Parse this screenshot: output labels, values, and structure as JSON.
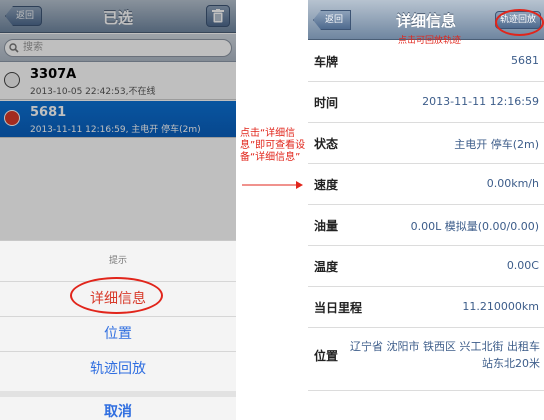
{
  "left_screen": {
    "nav": {
      "back_label": "返回",
      "title": "已选"
    },
    "search": {
      "placeholder": "搜索"
    },
    "vehicles": [
      {
        "plate": "3307A",
        "info": "2013-10-05 22:42:53,不在线"
      },
      {
        "plate": "5681",
        "info": "2013-11-11 12:16:59, 主电开 停车(2m)"
      }
    ],
    "action_sheet": {
      "title": "提示",
      "buttons": [
        "详细信息",
        "位置",
        "轨迹回放",
        "取消"
      ]
    }
  },
  "annotation": {
    "text": "点击“详细信息”即可查看设备“详细信息”",
    "hint": "点击可回放轨迹"
  },
  "right_screen": {
    "nav": {
      "back_label": "返回",
      "title": "详细信息",
      "playback_label": "轨迹回放"
    },
    "details": [
      {
        "label": "车牌",
        "value": "5681"
      },
      {
        "label": "时间",
        "value": "2013-11-11 12:16:59"
      },
      {
        "label": "状态",
        "value": "主电开  停车(2m)"
      },
      {
        "label": "速度",
        "value": "0.00km/h"
      },
      {
        "label": "油量",
        "value": "0.00L 模拟量(0.00/0.00)"
      },
      {
        "label": "温度",
        "value": "0.00C"
      },
      {
        "label": "当日里程",
        "value": "11.210000km"
      },
      {
        "label": "位置",
        "value": "辽宁省 沈阳市 铁西区 兴工北街 出租车站东北20米"
      }
    ]
  },
  "colors": {
    "accent_red": "#e1251b",
    "selection_blue": "#0b6cd0",
    "action_blue": "#2f6ee0",
    "nav_gradient_top": "#b7c3d0",
    "nav_gradient_bottom": "#6f86a0"
  },
  "icons": [
    "trash-icon",
    "search-icon",
    "vehicle-offline-icon",
    "vehicle-online-icon",
    "arrow-right-icon"
  ]
}
